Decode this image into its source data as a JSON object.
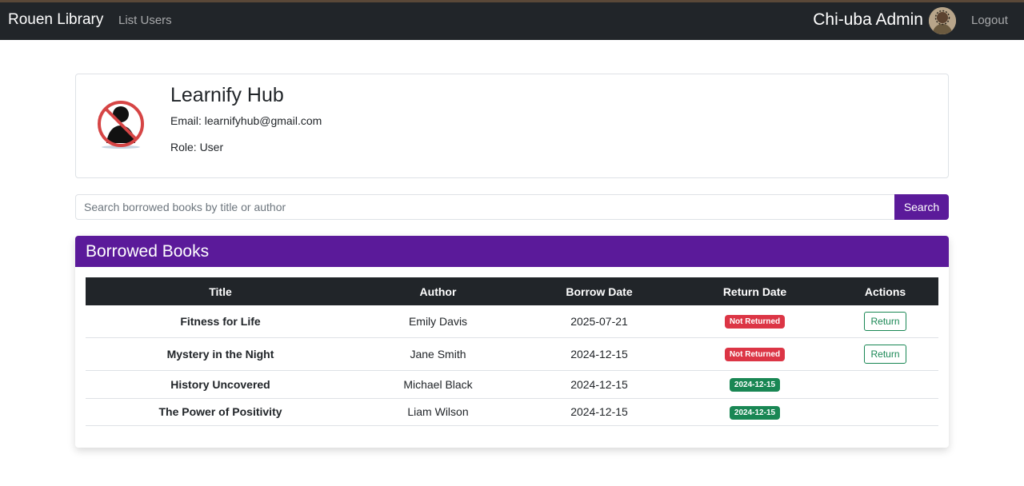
{
  "navbar": {
    "brand": "Rouen Library",
    "link_list_users": "List Users",
    "admin_name": "Chi-uba Admin",
    "logout": "Logout"
  },
  "profile": {
    "name": "Learnify Hub",
    "email": "Email: learnifyhub@gmail.com",
    "role": "Role: User"
  },
  "search": {
    "placeholder": "Search borrowed books by title or author",
    "button_label": "Search"
  },
  "borrowed": {
    "heading": "Borrowed Books",
    "columns": [
      "Title",
      "Author",
      "Borrow Date",
      "Return Date",
      "Actions"
    ],
    "rows": [
      {
        "title": "Fitness for Life",
        "author": "Emily Davis",
        "borrow_date": "2025-07-21",
        "return_date": "Not Returned",
        "status": "danger",
        "action": "Return"
      },
      {
        "title": "Mystery in the Night",
        "author": "Jane Smith",
        "borrow_date": "2024-12-15",
        "return_date": "Not Returned",
        "status": "danger",
        "action": "Return"
      },
      {
        "title": "History Uncovered",
        "author": "Michael Black",
        "borrow_date": "2024-12-15",
        "return_date": "2024-12-15",
        "status": "success",
        "action": ""
      },
      {
        "title": "The Power of Positivity",
        "author": "Liam Wilson",
        "borrow_date": "2024-12-15",
        "return_date": "2024-12-15",
        "status": "success",
        "action": ""
      }
    ]
  },
  "colors": {
    "navbar": "#212529",
    "accent": "#5b1a9a",
    "danger": "#dc3545",
    "success": "#198754"
  }
}
